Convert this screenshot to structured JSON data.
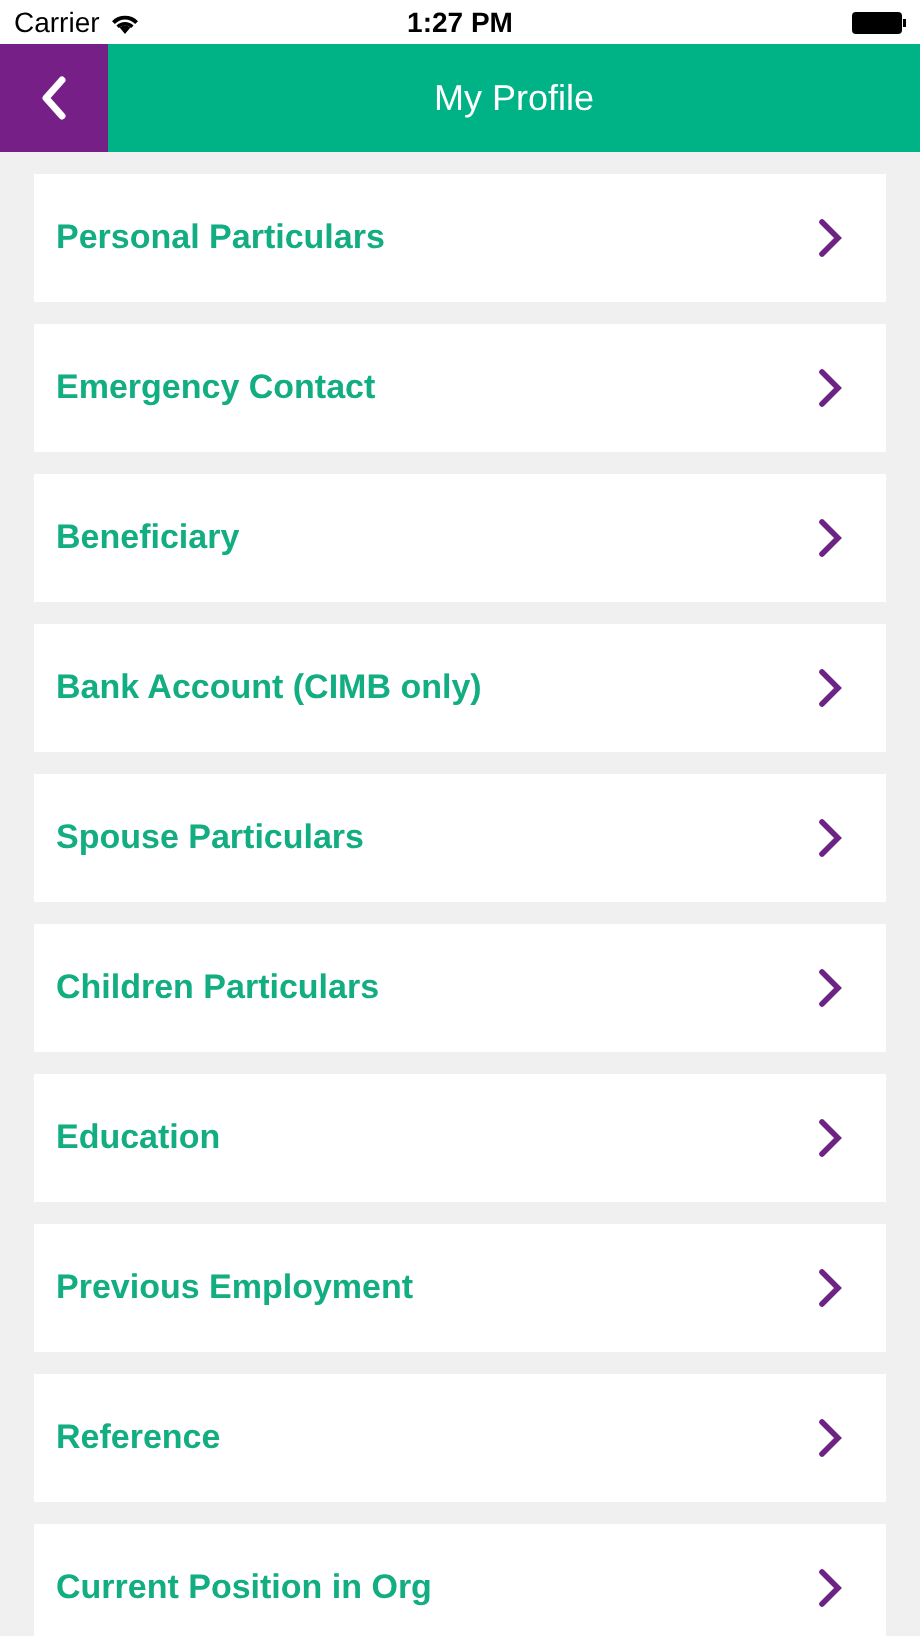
{
  "status_bar": {
    "carrier": "Carrier",
    "time": "1:27 PM"
  },
  "header": {
    "title": "My Profile"
  },
  "menu": [
    {
      "label": "Personal Particulars"
    },
    {
      "label": "Emergency Contact"
    },
    {
      "label": "Beneficiary"
    },
    {
      "label": "Bank Account (CIMB only)"
    },
    {
      "label": "Spouse Particulars"
    },
    {
      "label": "Children Particulars"
    },
    {
      "label": "Education"
    },
    {
      "label": "Previous Employment"
    },
    {
      "label": "Reference"
    },
    {
      "label": "Current Position in Org"
    }
  ]
}
